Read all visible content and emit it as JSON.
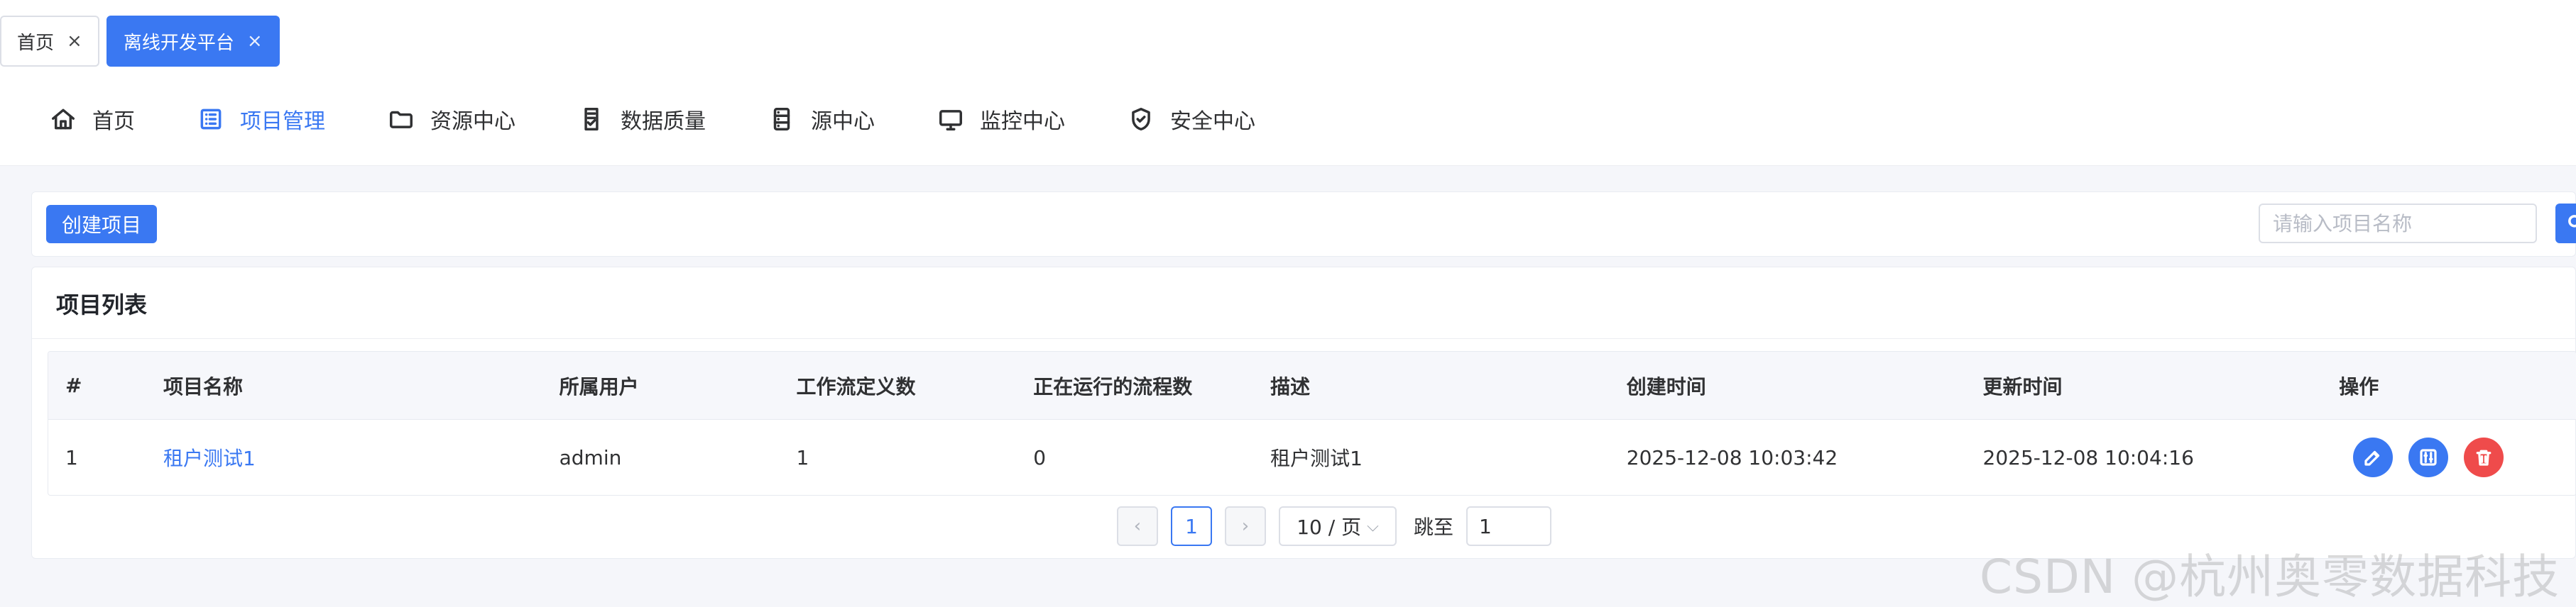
{
  "tabs": [
    {
      "label": "首页",
      "active": false
    },
    {
      "label": "离线开发平台",
      "active": true
    }
  ],
  "tabs_close_icon": "×",
  "nav": [
    {
      "label": "首页",
      "icon": "home-icon",
      "active": false
    },
    {
      "label": "项目管理",
      "icon": "list-icon",
      "active": true
    },
    {
      "label": "资源中心",
      "icon": "folder-icon",
      "active": false
    },
    {
      "label": "数据质量",
      "icon": "document-check-icon",
      "active": false
    },
    {
      "label": "源中心",
      "icon": "database-icon",
      "active": false
    },
    {
      "label": "监控中心",
      "icon": "monitor-icon",
      "active": false
    },
    {
      "label": "安全中心",
      "icon": "shield-check-icon",
      "active": false
    }
  ],
  "toolbar": {
    "create_label": "创建项目",
    "search_placeholder": "请输入项目名称"
  },
  "list": {
    "title": "项目列表",
    "columns": [
      "#",
      "项目名称",
      "所属用户",
      "工作流定义数",
      "正在运行的流程数",
      "描述",
      "创建时间",
      "更新时间",
      "操作"
    ],
    "rows": [
      {
        "index": "1",
        "name": "租户测试1",
        "owner": "admin",
        "workflow_count": "1",
        "running_count": "0",
        "desc": "租户测试1",
        "created": "2025-12-08 10:03:42",
        "updated": "2025-12-08 10:04:16"
      }
    ]
  },
  "pagination": {
    "prev_label": "‹",
    "next_label": "›",
    "current_page": "1",
    "page_size_label": "10 / 页",
    "page_size_chevron": "⌵",
    "jump_label": "跳至",
    "jump_value": "1"
  },
  "watermark": "CSDN @杭州奥零数据科技"
}
